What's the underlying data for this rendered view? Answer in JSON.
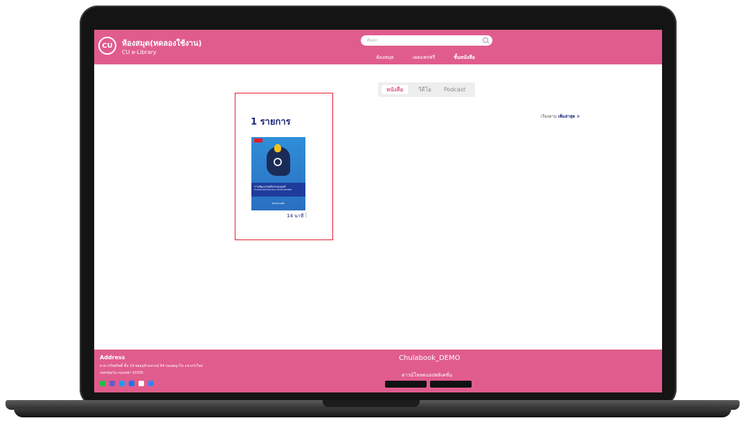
{
  "header": {
    "logo_text": "CU",
    "brand_title": "ห้องสมุด(ทดลองใช้งาน)",
    "brand_subtitle": "CU e-Library",
    "search_placeholder": "ค้นหา",
    "nav": [
      "ห้องสมุด",
      "เผยแพร่ฟรี",
      "ชั้นหนังสือ"
    ]
  },
  "tabs": [
    "หนังสือ",
    "วีดีโอ",
    "Podcast"
  ],
  "sort": {
    "label": "เรียงตาม",
    "value": "เพิ่มล่าสุด >"
  },
  "results": {
    "count_label": "1 รายการ"
  },
  "book": {
    "cover_title": "การพัฒนาพฤติกรรมมนุษย์",
    "cover_subtitle": "HUMAN BEHAVIORAL DEVELOPMENT",
    "cover_author": "ชินรัตน์ สมสืบ",
    "duration": "14 นาที",
    "more_icon": "⋮"
  },
  "footer": {
    "address_title": "Address",
    "address_line1": "อาคารวิทยกิตติ์ ชั้น 14 ซอยจุฬาลงกรณ์ 64 ถนนพญาไท แขวงวังใหม่",
    "address_line2": "เขตปทุมวัน กรุงเทพฯ 10330",
    "brand": "Chulabook_DEMO",
    "download_label": "ดาวน์โหลดแอปพลิเคชั่น",
    "social_colors": [
      "#1fbf4b",
      "#6a5acd",
      "#1d9bf0",
      "#1877f2",
      "#ffffff",
      "#3b82f6"
    ]
  },
  "colors": {
    "brand_pink": "#e05c8c",
    "navy": "#1e2a78",
    "highlight_red": "#e11d2a"
  }
}
